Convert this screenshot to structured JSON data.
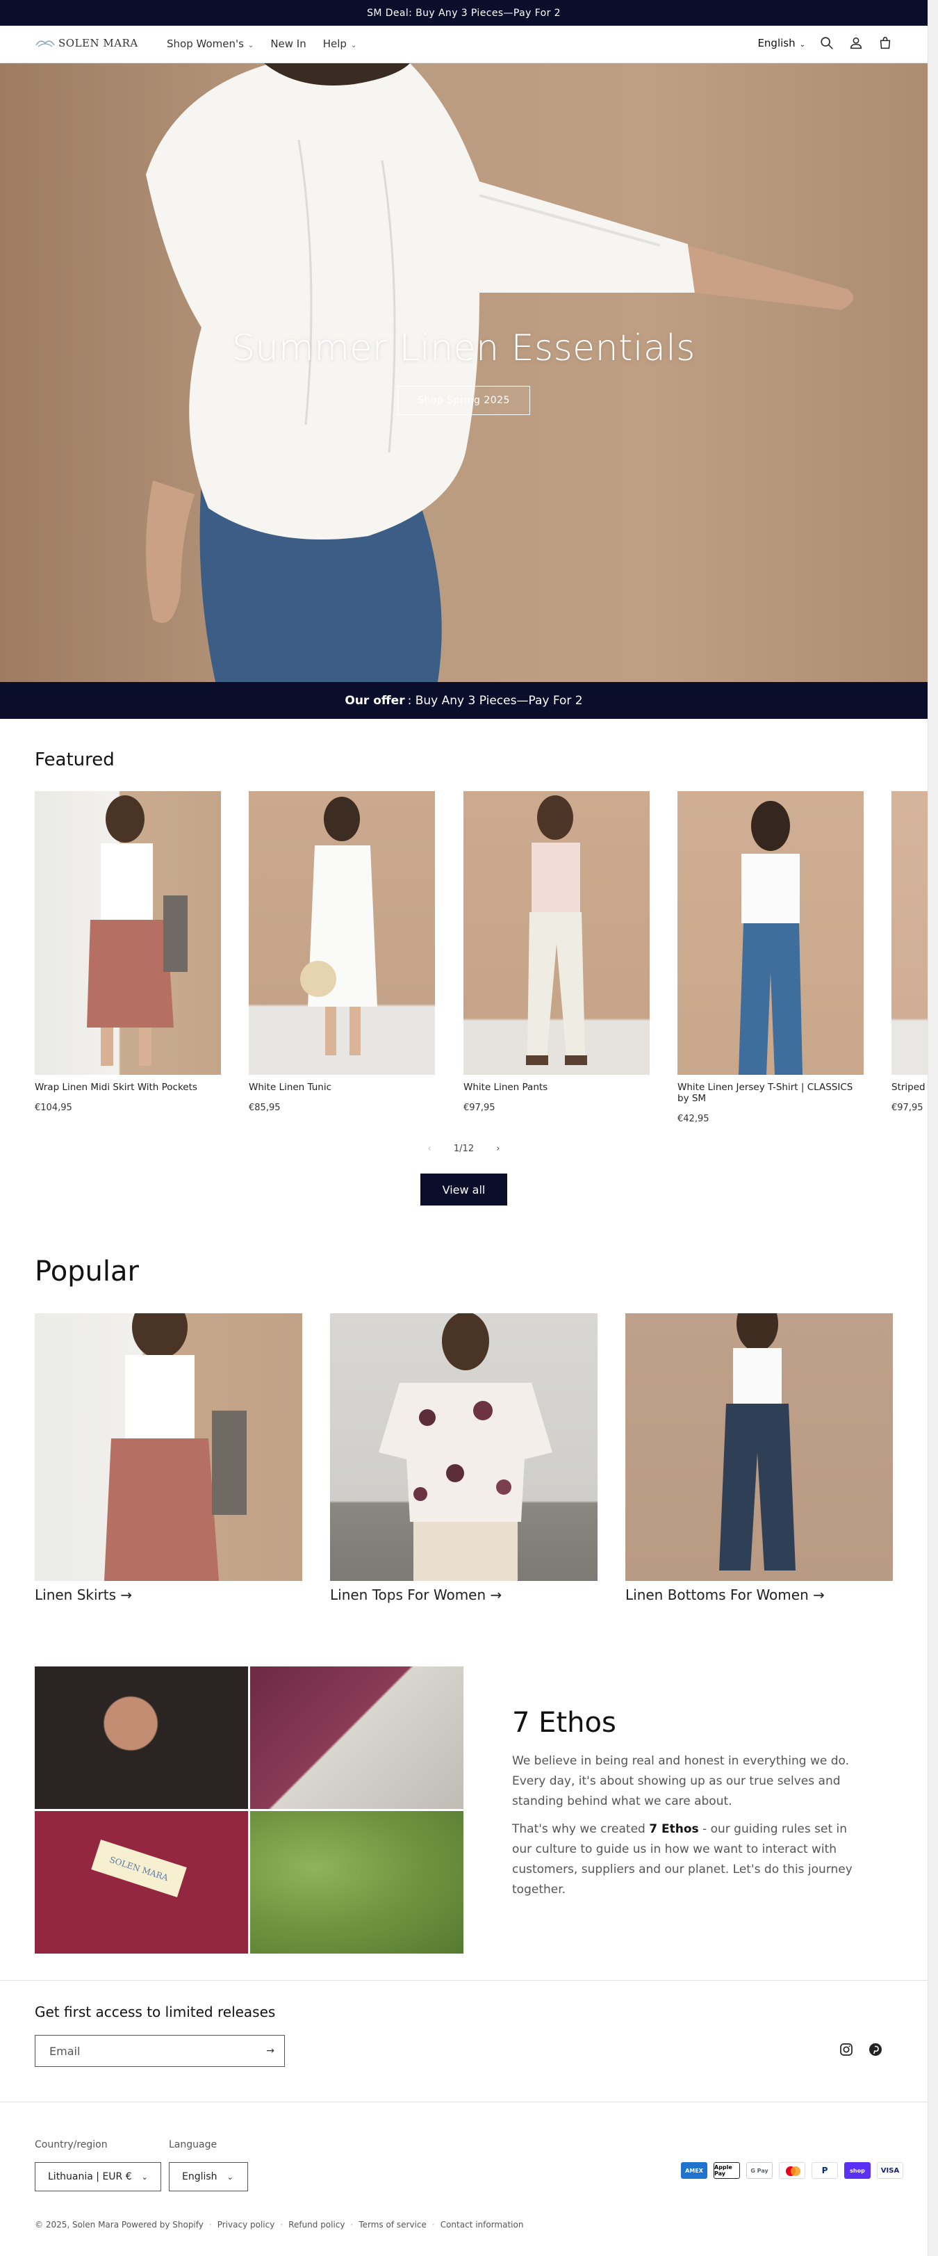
{
  "announcement": "SM Deal: Buy Any 3 Pieces—Pay For 2",
  "header": {
    "logo_text": "SOLEN MARA",
    "nav": [
      {
        "label": "Shop Women's",
        "dropdown": true
      },
      {
        "label": "New In",
        "dropdown": false
      },
      {
        "label": "Help",
        "dropdown": true
      }
    ],
    "language": "English"
  },
  "hero": {
    "title": "Summer Linen Essentials",
    "button": "Shop Spring 2025"
  },
  "offer": {
    "bold": "Our offer",
    "text": ": Buy Any 3 Pieces—Pay For 2"
  },
  "featured": {
    "title": "Featured",
    "products": [
      {
        "name": "Wrap Linen Midi Skirt With Pockets",
        "price": "€104,95"
      },
      {
        "name": "White Linen Tunic",
        "price": "€85,95"
      },
      {
        "name": "White Linen Pants",
        "price": "€97,95"
      },
      {
        "name": "White Linen Jersey T-Shirt | CLASSICS by SM",
        "price": "€42,95"
      },
      {
        "name": "Striped",
        "price": "€97,95"
      }
    ],
    "pager": "1/12",
    "view_all": "View all"
  },
  "popular": {
    "title": "Popular",
    "collections": [
      {
        "label": "Linen Skirts →"
      },
      {
        "label": "Linen Tops For Women →"
      },
      {
        "label": "Linen Bottoms For Women →"
      }
    ]
  },
  "ethos": {
    "title": "7 Ethos",
    "p1": "We believe in being real and honest in everything we do. Every day, it's about showing up as our true selves and standing behind what we care about.",
    "p2_before": "That's why we created ",
    "p2_bold": "7 Ethos",
    "p2_after": " - our guiding rules set in our culture to guide us in how we want to interact with customers, suppliers and our planet. Let's do this journey together.",
    "label_text": "SOLEN MARA"
  },
  "newsletter": {
    "title": "Get first access to limited releases",
    "placeholder": "Email"
  },
  "footer": {
    "country_label": "Country/region",
    "country_value": "Lithuania | EUR €",
    "language_label": "Language",
    "language_value": "English",
    "payments": [
      "AMEX",
      "Apple Pay",
      "G Pay",
      "Mastercard",
      "PayPal",
      "shop",
      "VISA"
    ],
    "copyright": "© 2025, Solen Mara Powered by Shopify",
    "links": [
      "Privacy policy",
      "Refund policy",
      "Terms of service",
      "Contact information"
    ]
  }
}
